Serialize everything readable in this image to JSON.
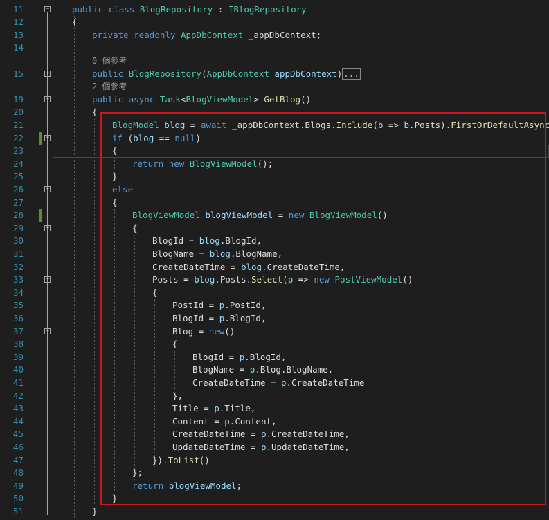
{
  "editor": {
    "lines": [
      {
        "n": "11",
        "indent": 0,
        "fold": "minus",
        "tokens": [
          [
            "public",
            "kw"
          ],
          [
            " ",
            "df"
          ],
          [
            "class",
            "kw"
          ],
          [
            " ",
            "df"
          ],
          [
            "BlogRepository",
            "ty"
          ],
          [
            " : ",
            "df"
          ],
          [
            "IBlogRepository",
            "ty"
          ]
        ]
      },
      {
        "n": "12",
        "indent": 0,
        "tokens": [
          [
            "{",
            "df"
          ]
        ]
      },
      {
        "n": "13",
        "indent": 1,
        "tokens": [
          [
            "private",
            "kw"
          ],
          [
            " ",
            "df"
          ],
          [
            "readonly",
            "kw"
          ],
          [
            " ",
            "df"
          ],
          [
            "AppDbContext",
            "ty"
          ],
          [
            " _appDbContext;",
            "df"
          ]
        ]
      },
      {
        "n": "14",
        "indent": 1,
        "tokens": []
      },
      {
        "hint": "0 個參考",
        "indent": 1
      },
      {
        "n": "15",
        "indent": 1,
        "fold": "plus",
        "tokens": [
          [
            "public",
            "kw"
          ],
          [
            " ",
            "df"
          ],
          [
            "BlogRepository",
            "ty"
          ],
          [
            "(",
            "df"
          ],
          [
            "AppDbContext",
            "ty"
          ],
          [
            " ",
            "df"
          ],
          [
            "appDbContext",
            "pa"
          ],
          [
            ")",
            "df"
          ]
        ],
        "ellipsis": "..."
      },
      {
        "hint": "2 個參考",
        "indent": 1
      },
      {
        "n": "19",
        "indent": 1,
        "fold": "minus",
        "tokens": [
          [
            "public",
            "kw"
          ],
          [
            " ",
            "df"
          ],
          [
            "async",
            "kw"
          ],
          [
            " ",
            "df"
          ],
          [
            "Task",
            "ty"
          ],
          [
            "<",
            "df"
          ],
          [
            "BlogViewModel",
            "ty"
          ],
          [
            "> ",
            "df"
          ],
          [
            "GetBlog",
            "me"
          ],
          [
            "()",
            "df"
          ]
        ]
      },
      {
        "n": "20",
        "indent": 1,
        "tokens": [
          [
            "{",
            "df"
          ]
        ]
      },
      {
        "n": "21",
        "indent": 2,
        "tokens": [
          [
            "BlogModel",
            "ty"
          ],
          [
            " ",
            "df"
          ],
          [
            "blog",
            "pa"
          ],
          [
            " = ",
            "df"
          ],
          [
            "await",
            "kw"
          ],
          [
            " _appDbContext.Blogs.",
            "df"
          ],
          [
            "Include",
            "me"
          ],
          [
            "(",
            "df"
          ],
          [
            "b",
            "pa"
          ],
          [
            " => ",
            "df"
          ],
          [
            "b",
            "pa"
          ],
          [
            ".Posts).",
            "df"
          ],
          [
            "FirstOrDefaultAsync",
            "me"
          ],
          [
            "();",
            "df"
          ]
        ]
      },
      {
        "n": "22",
        "indent": 2,
        "fold": "minus",
        "mod": true,
        "tokens": [
          [
            "if",
            "kw"
          ],
          [
            " (",
            "df"
          ],
          [
            "blog",
            "pa"
          ],
          [
            " == ",
            "df"
          ],
          [
            "null",
            "kw"
          ],
          [
            ")",
            "df"
          ]
        ]
      },
      {
        "n": "23",
        "indent": 2,
        "current": true,
        "tokens": [
          [
            "{",
            "df"
          ]
        ]
      },
      {
        "n": "24",
        "indent": 3,
        "tokens": [
          [
            "return",
            "kw"
          ],
          [
            " ",
            "df"
          ],
          [
            "new",
            "kw"
          ],
          [
            " ",
            "df"
          ],
          [
            "BlogViewModel",
            "ty"
          ],
          [
            "();",
            "df"
          ]
        ]
      },
      {
        "n": "25",
        "indent": 2,
        "tokens": [
          [
            "}",
            "df"
          ]
        ]
      },
      {
        "n": "26",
        "indent": 2,
        "fold": "minus",
        "tokens": [
          [
            "else",
            "kw"
          ]
        ]
      },
      {
        "n": "27",
        "indent": 2,
        "tokens": [
          [
            "{",
            "df"
          ]
        ]
      },
      {
        "n": "28",
        "indent": 3,
        "mod": true,
        "tokens": [
          [
            "BlogViewModel",
            "ty"
          ],
          [
            " ",
            "df"
          ],
          [
            "blogViewModel",
            "pa"
          ],
          [
            " = ",
            "df"
          ],
          [
            "new",
            "kw"
          ],
          [
            " ",
            "df"
          ],
          [
            "BlogViewModel",
            "ty"
          ],
          [
            "()",
            "df"
          ]
        ]
      },
      {
        "n": "29",
        "indent": 3,
        "fold": "minus",
        "tokens": [
          [
            "{",
            "df"
          ]
        ]
      },
      {
        "n": "30",
        "indent": 4,
        "tokens": [
          [
            "BlogId = ",
            "df"
          ],
          [
            "blog",
            "pa"
          ],
          [
            ".BlogId,",
            "df"
          ]
        ]
      },
      {
        "n": "31",
        "indent": 4,
        "tokens": [
          [
            "BlogName = ",
            "df"
          ],
          [
            "blog",
            "pa"
          ],
          [
            ".BlogName,",
            "df"
          ]
        ]
      },
      {
        "n": "32",
        "indent": 4,
        "tokens": [
          [
            "CreateDateTime = ",
            "df"
          ],
          [
            "blog",
            "pa"
          ],
          [
            ".CreateDateTime,",
            "df"
          ]
        ]
      },
      {
        "n": "33",
        "indent": 4,
        "fold": "minus",
        "tokens": [
          [
            "Posts = ",
            "df"
          ],
          [
            "blog",
            "pa"
          ],
          [
            ".Posts.",
            "df"
          ],
          [
            "Select",
            "me"
          ],
          [
            "(",
            "df"
          ],
          [
            "p",
            "pa"
          ],
          [
            " => ",
            "df"
          ],
          [
            "new",
            "kw"
          ],
          [
            " ",
            "df"
          ],
          [
            "PostViewModel",
            "ty"
          ],
          [
            "()",
            "df"
          ]
        ]
      },
      {
        "n": "34",
        "indent": 4,
        "tokens": [
          [
            "{",
            "df"
          ]
        ]
      },
      {
        "n": "35",
        "indent": 5,
        "tokens": [
          [
            "PostId = ",
            "df"
          ],
          [
            "p",
            "pa"
          ],
          [
            ".PostId,",
            "df"
          ]
        ]
      },
      {
        "n": "36",
        "indent": 5,
        "tokens": [
          [
            "BlogId = ",
            "df"
          ],
          [
            "p",
            "pa"
          ],
          [
            ".BlogId,",
            "df"
          ]
        ]
      },
      {
        "n": "37",
        "indent": 5,
        "fold": "minus",
        "tokens": [
          [
            "Blog = ",
            "df"
          ],
          [
            "new",
            "kw"
          ],
          [
            "()",
            "df"
          ]
        ]
      },
      {
        "n": "38",
        "indent": 5,
        "tokens": [
          [
            "{",
            "df"
          ]
        ]
      },
      {
        "n": "39",
        "indent": 6,
        "tokens": [
          [
            "BlogId = ",
            "df"
          ],
          [
            "p",
            "pa"
          ],
          [
            ".BlogId,",
            "df"
          ]
        ]
      },
      {
        "n": "40",
        "indent": 6,
        "tokens": [
          [
            "BlogName = ",
            "df"
          ],
          [
            "p",
            "pa"
          ],
          [
            ".Blog.BlogName,",
            "df"
          ]
        ]
      },
      {
        "n": "41",
        "indent": 6,
        "tokens": [
          [
            "CreateDateTime = ",
            "df"
          ],
          [
            "p",
            "pa"
          ],
          [
            ".CreateDateTime",
            "df"
          ]
        ]
      },
      {
        "n": "42",
        "indent": 5,
        "tokens": [
          [
            "},",
            "df"
          ]
        ]
      },
      {
        "n": "43",
        "indent": 5,
        "tokens": [
          [
            "Title = ",
            "df"
          ],
          [
            "p",
            "pa"
          ],
          [
            ".Title,",
            "df"
          ]
        ]
      },
      {
        "n": "44",
        "indent": 5,
        "tokens": [
          [
            "Content = ",
            "df"
          ],
          [
            "p",
            "pa"
          ],
          [
            ".Content,",
            "df"
          ]
        ]
      },
      {
        "n": "45",
        "indent": 5,
        "tokens": [
          [
            "CreateDateTime = ",
            "df"
          ],
          [
            "p",
            "pa"
          ],
          [
            ".CreateDateTime,",
            "df"
          ]
        ]
      },
      {
        "n": "46",
        "indent": 5,
        "tokens": [
          [
            "UpdateDateTime = ",
            "df"
          ],
          [
            "p",
            "pa"
          ],
          [
            ".UpdateDateTime,",
            "df"
          ]
        ]
      },
      {
        "n": "47",
        "indent": 4,
        "tokens": [
          [
            "}).",
            "df"
          ],
          [
            "ToList",
            "me"
          ],
          [
            "()",
            "df"
          ]
        ]
      },
      {
        "n": "48",
        "indent": 3,
        "tokens": [
          [
            "};",
            "df"
          ]
        ]
      },
      {
        "n": "49",
        "indent": 3,
        "tokens": [
          [
            "return",
            "kw"
          ],
          [
            " ",
            "df"
          ],
          [
            "blogViewModel",
            "pa"
          ],
          [
            ";",
            "df"
          ]
        ]
      },
      {
        "n": "50",
        "indent": 2,
        "tokens": [
          [
            "}",
            "df"
          ]
        ]
      },
      {
        "n": "51",
        "indent": 1,
        "tokens": [
          [
            "}",
            "df"
          ]
        ]
      }
    ]
  },
  "colors": {
    "keyword": "#569cd6",
    "type": "#4ec9b0",
    "method": "#dcdcaa",
    "parameter": "#9cdcfe",
    "highlight_box": "#c8171e",
    "modified_bar": "#5e8d38"
  }
}
